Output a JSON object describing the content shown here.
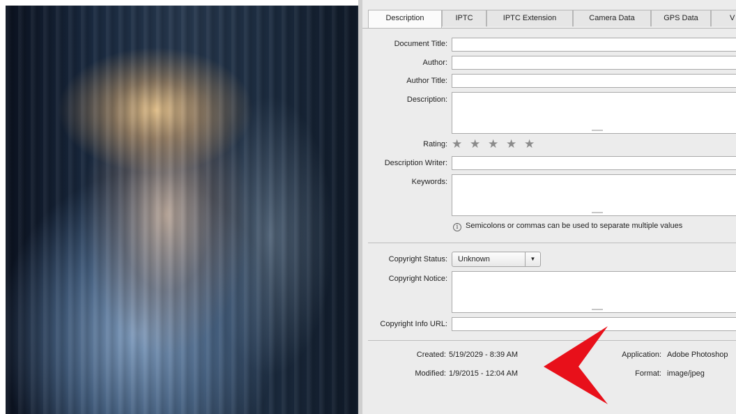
{
  "tabs": [
    {
      "label": "Description",
      "active": true
    },
    {
      "label": "IPTC",
      "active": false
    },
    {
      "label": "IPTC Extension",
      "active": false
    },
    {
      "label": "Camera Data",
      "active": false
    },
    {
      "label": "GPS Data",
      "active": false
    },
    {
      "label": "V",
      "active": false
    }
  ],
  "fields": {
    "document_title": {
      "label": "Document Title:",
      "value": ""
    },
    "author": {
      "label": "Author:",
      "value": ""
    },
    "author_title": {
      "label": "Author Title:",
      "value": ""
    },
    "description": {
      "label": "Description:",
      "value": ""
    },
    "rating": {
      "label": "Rating:",
      "value": 0,
      "max": 5
    },
    "description_writer": {
      "label": "Description Writer:",
      "value": ""
    },
    "keywords": {
      "label": "Keywords:",
      "value": ""
    },
    "keywords_hint": "Semicolons or commas can be used to separate multiple values",
    "copyright_status": {
      "label": "Copyright Status:",
      "value": "Unknown"
    },
    "copyright_notice": {
      "label": "Copyright Notice:",
      "value": ""
    },
    "copyright_url": {
      "label": "Copyright Info URL:",
      "value": ""
    }
  },
  "meta": {
    "created_label": "Created:",
    "created_value": "5/19/2029 - 8:39 AM",
    "modified_label": "Modified:",
    "modified_value": "1/9/2015 - 12:04 AM",
    "application_label": "Application:",
    "application_value": "Adobe Photoshop",
    "format_label": "Format:",
    "format_value": "image/jpeg"
  },
  "icons": {
    "star": "★",
    "info": "i",
    "dropdown": "▼"
  },
  "colors": {
    "arrow": "#e8101a",
    "panel_bg": "#ececec",
    "star": "#8b8b8b"
  }
}
